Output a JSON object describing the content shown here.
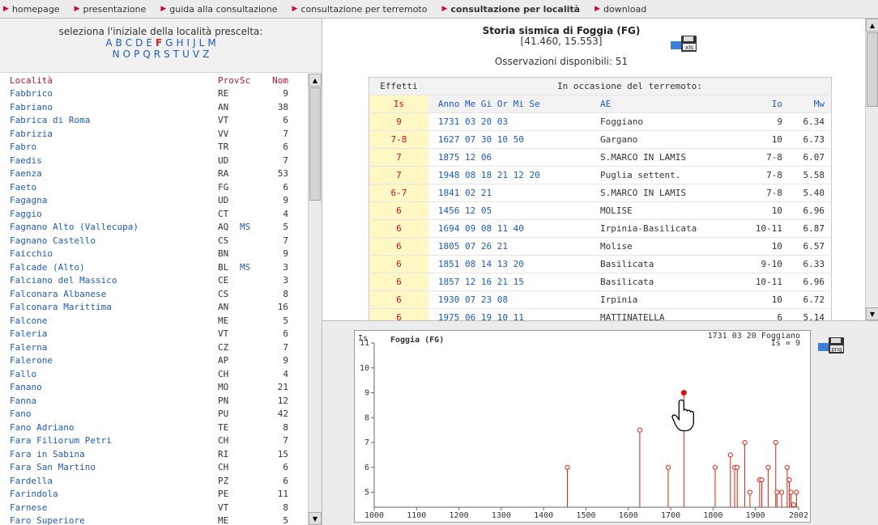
{
  "nav": {
    "items": [
      {
        "label": "homepage",
        "active": false
      },
      {
        "label": "presentazione",
        "active": false
      },
      {
        "label": "guida alla consultazione",
        "active": false
      },
      {
        "label": "consultazione per terremoto",
        "active": false
      },
      {
        "label": "consultazione per località",
        "active": true
      },
      {
        "label": "download",
        "active": false
      }
    ]
  },
  "left": {
    "prompt": "seleziona l'iniziale della località prescelta:",
    "letters_row1": [
      "A",
      "B",
      "C",
      "D",
      "E",
      "F",
      "G",
      "H",
      "I",
      "J",
      "L",
      "M"
    ],
    "letters_row2": [
      "N",
      "O",
      "P",
      "Q",
      "R",
      "S",
      "T",
      "U",
      "V",
      "Z"
    ],
    "selected_letter": "F",
    "headers": {
      "name": "Località",
      "prov": "Prov",
      "sc": "Sc",
      "nom": "Nom"
    },
    "rows": [
      {
        "name": "Fabbrico",
        "prov": "RE",
        "sc": "",
        "nom": "9"
      },
      {
        "name": "Fabriano",
        "prov": "AN",
        "sc": "",
        "nom": "38"
      },
      {
        "name": "Fabrica di Roma",
        "prov": "VT",
        "sc": "",
        "nom": "6"
      },
      {
        "name": "Fabrizia",
        "prov": "VV",
        "sc": "",
        "nom": "7"
      },
      {
        "name": "Fabro",
        "prov": "TR",
        "sc": "",
        "nom": "6"
      },
      {
        "name": "Faedis",
        "prov": "UD",
        "sc": "",
        "nom": "7"
      },
      {
        "name": "Faenza",
        "prov": "RA",
        "sc": "",
        "nom": "53"
      },
      {
        "name": "Faeto",
        "prov": "FG",
        "sc": "",
        "nom": "6"
      },
      {
        "name": "Fagagna",
        "prov": "UD",
        "sc": "",
        "nom": "9"
      },
      {
        "name": "Faggio",
        "prov": "CT",
        "sc": "",
        "nom": "4"
      },
      {
        "name": "Fagnano Alto (Vallecupa)",
        "prov": "AQ",
        "sc": "MS",
        "nom": "5"
      },
      {
        "name": "Fagnano Castello",
        "prov": "CS",
        "sc": "",
        "nom": "7"
      },
      {
        "name": "Faicchio",
        "prov": "BN",
        "sc": "",
        "nom": "9"
      },
      {
        "name": "Falcade (Alto)",
        "prov": "BL",
        "sc": "MS",
        "nom": "3"
      },
      {
        "name": "Falciano del Massico",
        "prov": "CE",
        "sc": "",
        "nom": "3"
      },
      {
        "name": "Falconara Albanese",
        "prov": "CS",
        "sc": "",
        "nom": "8"
      },
      {
        "name": "Falconara Marittima",
        "prov": "AN",
        "sc": "",
        "nom": "16"
      },
      {
        "name": "Falcone",
        "prov": "ME",
        "sc": "",
        "nom": "5"
      },
      {
        "name": "Faleria",
        "prov": "VT",
        "sc": "",
        "nom": "6"
      },
      {
        "name": "Falerna",
        "prov": "CZ",
        "sc": "",
        "nom": "7"
      },
      {
        "name": "Falerone",
        "prov": "AP",
        "sc": "",
        "nom": "9"
      },
      {
        "name": "Fallo",
        "prov": "CH",
        "sc": "",
        "nom": "4"
      },
      {
        "name": "Fanano",
        "prov": "MO",
        "sc": "",
        "nom": "21"
      },
      {
        "name": "Fanna",
        "prov": "PN",
        "sc": "",
        "nom": "12"
      },
      {
        "name": "Fano",
        "prov": "PU",
        "sc": "",
        "nom": "42"
      },
      {
        "name": "Fano Adriano",
        "prov": "TE",
        "sc": "",
        "nom": "8"
      },
      {
        "name": "Fara Filiorum Petri",
        "prov": "CH",
        "sc": "",
        "nom": "7"
      },
      {
        "name": "Fara in Sabina",
        "prov": "RI",
        "sc": "",
        "nom": "15"
      },
      {
        "name": "Fara San Martino",
        "prov": "CH",
        "sc": "",
        "nom": "6"
      },
      {
        "name": "Fardella",
        "prov": "PZ",
        "sc": "",
        "nom": "6"
      },
      {
        "name": "Farindola",
        "prov": "PE",
        "sc": "",
        "nom": "11"
      },
      {
        "name": "Farnese",
        "prov": "VT",
        "sc": "",
        "nom": "8"
      },
      {
        "name": "Faro Superiore",
        "prov": "ME",
        "sc": "",
        "nom": "5"
      }
    ]
  },
  "history": {
    "title": "Storia sismica di Foggia (FG)",
    "coords": "[41.460, 15.553]",
    "observations": "Osservazioni disponibili: 51",
    "icons": {
      "xls": "xls-download-icon",
      "png": "png-download-icon"
    },
    "xls_label": "xls",
    "png_label": "png",
    "table_headers": {
      "effetti": "Effetti",
      "occasione": "In occasione del terremoto:",
      "is": "Is",
      "date": "Anno Me Gi Or Mi Se",
      "ae": "AE",
      "io": "Io",
      "mw": "Mw"
    },
    "rows": [
      {
        "is": "9",
        "date": "1731 03 20 03",
        "ae": "Foggiano",
        "io": "9",
        "mw": "6.34"
      },
      {
        "is": "7-8",
        "date": "1627 07 30 10 50",
        "ae": "Gargano",
        "io": "10",
        "mw": "6.73"
      },
      {
        "is": "7",
        "date": "1875 12 06",
        "ae": "S.MARCO IN LAMIS",
        "io": "7-8",
        "mw": "6.07"
      },
      {
        "is": "7",
        "date": "1948 08 18 21 12 20",
        "ae": "Puglia settent.",
        "io": "7-8",
        "mw": "5.58"
      },
      {
        "is": "6-7",
        "date": "1841 02 21",
        "ae": "S.MARCO IN LAMIS",
        "io": "7-8",
        "mw": "5.40"
      },
      {
        "is": "6",
        "date": "1456 12 05",
        "ae": "MOLISE",
        "io": "10",
        "mw": "6.96"
      },
      {
        "is": "6",
        "date": "1694 09 08 11 40",
        "ae": "Irpinia-Basilicata",
        "io": "10-11",
        "mw": "6.87"
      },
      {
        "is": "6",
        "date": "1805 07 26 21",
        "ae": "Molise",
        "io": "10",
        "mw": "6.57"
      },
      {
        "is": "6",
        "date": "1851 08 14 13 20",
        "ae": "Basilicata",
        "io": "9-10",
        "mw": "6.33"
      },
      {
        "is": "6",
        "date": "1857 12 16 21 15",
        "ae": "Basilicata",
        "io": "10-11",
        "mw": "6.96"
      },
      {
        "is": "6",
        "date": "1930 07 23 08",
        "ae": "Irpinia",
        "io": "10",
        "mw": "6.72"
      },
      {
        "is": "6",
        "date": "1975 06 19 10 11",
        "ae": "MATTINATELLA",
        "io": "6",
        "mw": "5.14"
      }
    ]
  },
  "chart_data": {
    "type": "scatter",
    "title": "Foggia (FG)",
    "ylabel": "Is",
    "annotation_line1": "1731 03 20 Foggiano",
    "annotation_line2": "Is = 9",
    "x_ticks": [
      1000,
      1100,
      1200,
      1300,
      1400,
      1500,
      1600,
      1700,
      1800,
      1900,
      2002
    ],
    "y_ticks": [
      5,
      6,
      7,
      8,
      9,
      10,
      11
    ],
    "xlim": [
      1000,
      2002
    ],
    "ylim": [
      4.4,
      11
    ],
    "highlight": {
      "x": 1731,
      "y": 9
    },
    "points": [
      {
        "x": 1456,
        "y": 6
      },
      {
        "x": 1627,
        "y": 7.5
      },
      {
        "x": 1694,
        "y": 6
      },
      {
        "x": 1731,
        "y": 9
      },
      {
        "x": 1805,
        "y": 6
      },
      {
        "x": 1841,
        "y": 6.5
      },
      {
        "x": 1851,
        "y": 6
      },
      {
        "x": 1857,
        "y": 6
      },
      {
        "x": 1875,
        "y": 7
      },
      {
        "x": 1887,
        "y": 5
      },
      {
        "x": 1910,
        "y": 5.5
      },
      {
        "x": 1915,
        "y": 5.5
      },
      {
        "x": 1930,
        "y": 6
      },
      {
        "x": 1948,
        "y": 7
      },
      {
        "x": 1951,
        "y": 5
      },
      {
        "x": 1962,
        "y": 5
      },
      {
        "x": 1975,
        "y": 6
      },
      {
        "x": 1980,
        "y": 5.5
      },
      {
        "x": 1984,
        "y": 5
      },
      {
        "x": 1990,
        "y": 4.5
      },
      {
        "x": 1997,
        "y": 5
      }
    ]
  }
}
